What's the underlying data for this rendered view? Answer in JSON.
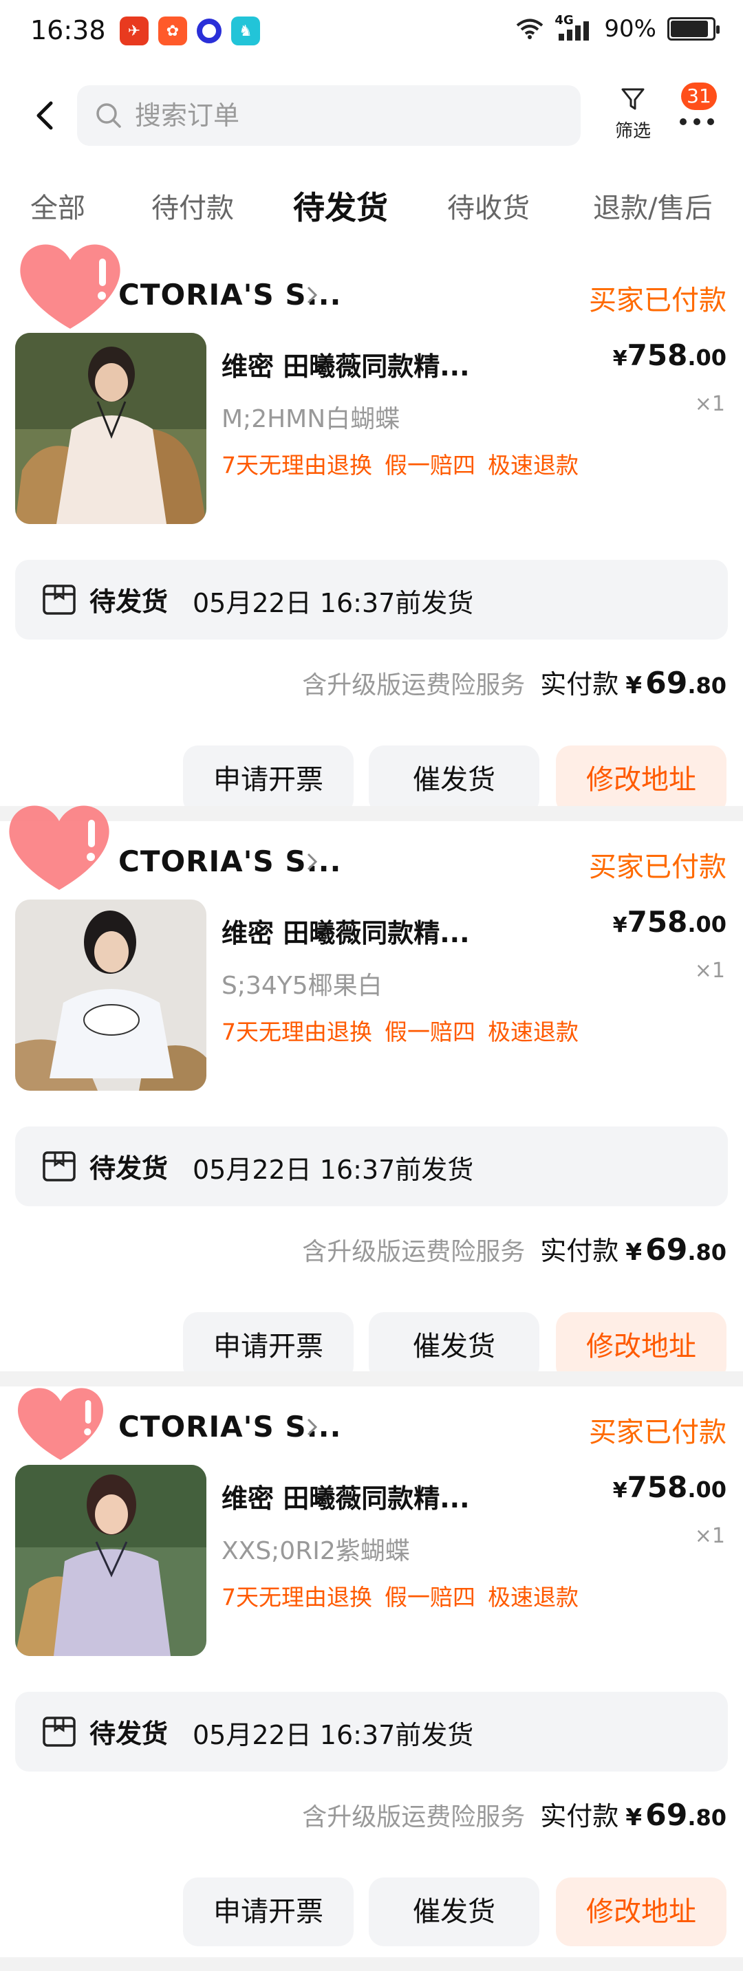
{
  "status_bar": {
    "time": "16:38",
    "network": "4G",
    "battery": "90%",
    "battery_level": 0.9
  },
  "header": {
    "search_placeholder": "搜索订单",
    "filter_label": "筛选",
    "notification_count": "31"
  },
  "tabs": [
    {
      "label": "全部",
      "active": false
    },
    {
      "label": "待付款",
      "active": false
    },
    {
      "label": "待发货",
      "active": true
    },
    {
      "label": "待收货",
      "active": false
    },
    {
      "label": "退款/售后",
      "active": false
    }
  ],
  "orders": [
    {
      "shop_name": "CTORIA'S S...",
      "status": "买家已付款",
      "product_title": "维密 田曦薇同款精...",
      "sku": "M;2HMN白蝴蝶",
      "price_currency": "¥",
      "price_int": "758",
      "price_dec": ".00",
      "quantity": "×1",
      "tags": [
        "7天无理由退换",
        "假一赔四",
        "极速退款"
      ],
      "ship_status": "待发货",
      "ship_deadline": "05月22日 16:37前发货",
      "service": "含升级版运费险服务",
      "pay_label": "实付款",
      "pay_currency": "¥",
      "pay_int": "69",
      "pay_dec": ".80",
      "buttons": {
        "invoice": "申请开票",
        "urge": "催发货",
        "address": "修改地址"
      }
    },
    {
      "shop_name": "CTORIA'S S...",
      "status": "买家已付款",
      "product_title": "维密 田曦薇同款精...",
      "sku": "S;34Y5椰果白",
      "price_currency": "¥",
      "price_int": "758",
      "price_dec": ".00",
      "quantity": "×1",
      "tags": [
        "7天无理由退换",
        "假一赔四",
        "极速退款"
      ],
      "ship_status": "待发货",
      "ship_deadline": "05月22日 16:37前发货",
      "service": "含升级版运费险服务",
      "pay_label": "实付款",
      "pay_currency": "¥",
      "pay_int": "69",
      "pay_dec": ".80",
      "buttons": {
        "invoice": "申请开票",
        "urge": "催发货",
        "address": "修改地址"
      }
    },
    {
      "shop_name": "CTORIA'S S...",
      "status": "买家已付款",
      "product_title": "维密 田曦薇同款精...",
      "sku": "XXS;0RI2紫蝴蝶",
      "price_currency": "¥",
      "price_int": "758",
      "price_dec": ".00",
      "quantity": "×1",
      "tags": [
        "7天无理由退换",
        "假一赔四",
        "极速退款"
      ],
      "ship_status": "待发货",
      "ship_deadline": "05月22日 16:37前发货",
      "service": "含升级版运费险服务",
      "pay_label": "实付款",
      "pay_currency": "¥",
      "pay_int": "69",
      "pay_dec": ".80",
      "buttons": {
        "invoice": "申请开票",
        "urge": "催发货",
        "address": "修改地址"
      }
    }
  ],
  "colors": {
    "accent": "#ff6a00",
    "badge": "#ff4f1a",
    "button_bg": "#f3f4f6",
    "accent_button_bg": "#ffeee6"
  }
}
